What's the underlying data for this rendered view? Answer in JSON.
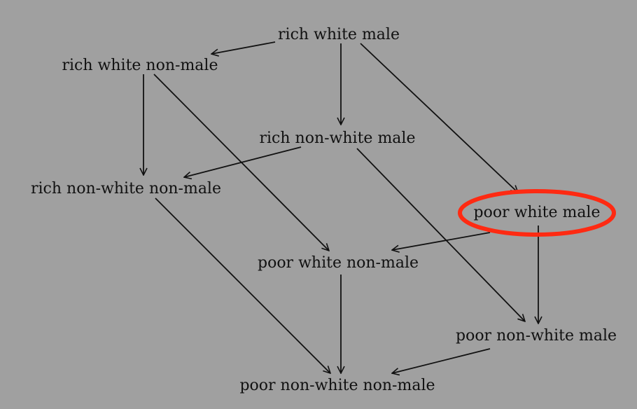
{
  "diagram": {
    "nodes": [
      {
        "id": "rwm",
        "label": "rich white male"
      },
      {
        "id": "rwnm",
        "label": "rich white non-male"
      },
      {
        "id": "rnwm",
        "label": "rich non-white male"
      },
      {
        "id": "rnwnm",
        "label": "rich non-white non-male"
      },
      {
        "id": "pwm",
        "label": "poor white male"
      },
      {
        "id": "pwnm",
        "label": "poor white non-male"
      },
      {
        "id": "pnwm",
        "label": "poor non-white male"
      },
      {
        "id": "pnwnm",
        "label": "poor non-white non-male"
      }
    ],
    "edges": [
      {
        "from": "rwm",
        "to": "rwnm"
      },
      {
        "from": "rwm",
        "to": "rnwm"
      },
      {
        "from": "rwm",
        "to": "pwm"
      },
      {
        "from": "rwnm",
        "to": "rnwnm"
      },
      {
        "from": "rwnm",
        "to": "pwnm"
      },
      {
        "from": "rnwm",
        "to": "rnwnm"
      },
      {
        "from": "rnwm",
        "to": "pnwm"
      },
      {
        "from": "rnwnm",
        "to": "pnwnm"
      },
      {
        "from": "pwm",
        "to": "pwnm"
      },
      {
        "from": "pwm",
        "to": "pnwm"
      },
      {
        "from": "pwnm",
        "to": "pnwnm"
      },
      {
        "from": "pnwm",
        "to": "pnwnm"
      }
    ],
    "highlighted_node": "pwm",
    "colors": {
      "background": "#a0a0a0",
      "text": "#111111",
      "edge": "#111111",
      "highlight": "#ff2a12"
    }
  }
}
